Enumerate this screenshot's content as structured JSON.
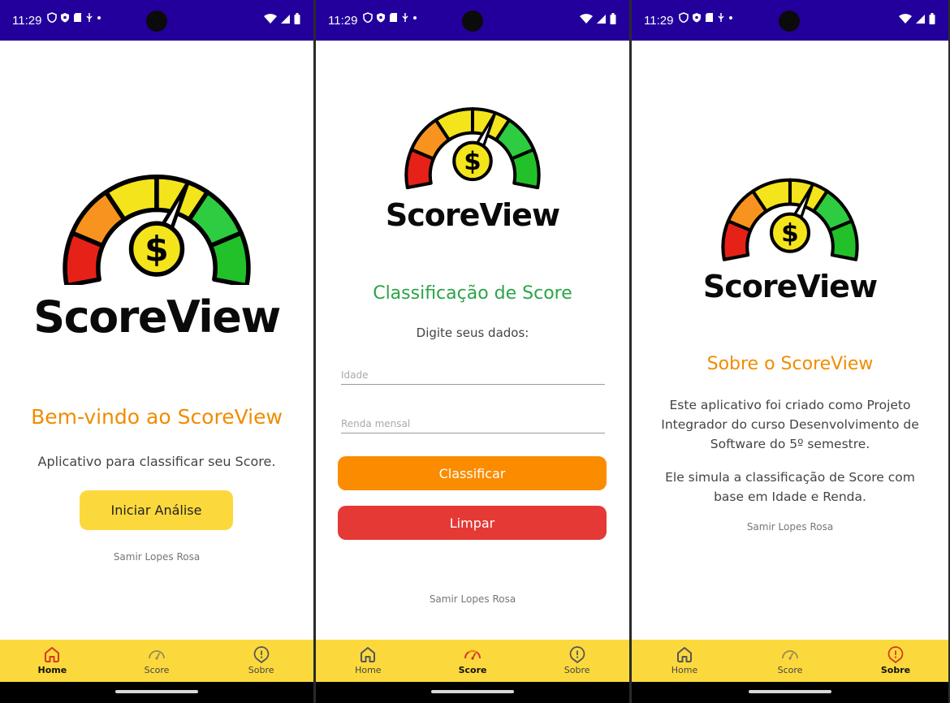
{
  "status": {
    "time": "11:29"
  },
  "brand": {
    "name": "ScoreView"
  },
  "author": "Samir Lopes Rosa",
  "nav": {
    "home": "Home",
    "score": "Score",
    "about": "Sobre"
  },
  "colors": {
    "status_bar": "#23009c",
    "nav_bar": "#fbd93d",
    "accent_orange": "#f08c00",
    "accent_green": "#2aa448",
    "danger_red": "#e53935",
    "button_yellow": "#fbd93d"
  },
  "screens": {
    "home": {
      "title": "Bem-vindo ao ScoreView",
      "subtitle": "Aplicativo para classificar seu Score.",
      "start_button": "Iniciar Análise"
    },
    "score": {
      "title": "Classificação de Score",
      "prompt": "Digite seus dados:",
      "age_placeholder": "Idade",
      "income_placeholder": "Renda mensal",
      "classify_button": "Classificar",
      "clear_button": "Limpar"
    },
    "about": {
      "title": "Sobre o ScoreView",
      "paragraph1": "Este aplicativo foi criado como Projeto Integrador do curso Desenvolvimento de Software do 5º semestre.",
      "paragraph2": "Ele simula a classificação de Score com base em Idade e Renda."
    }
  }
}
